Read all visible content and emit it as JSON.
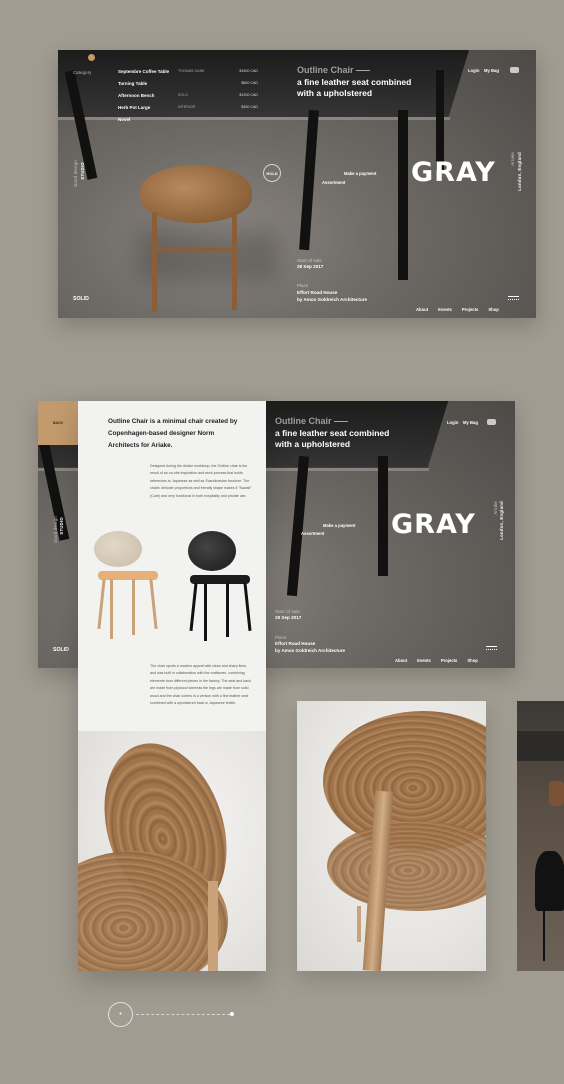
{
  "hero_top": {
    "brand": "SOLID",
    "menu_label": "Category",
    "menu": [
      {
        "name": "Septembre Coffee Table",
        "category": "THOMAS GANE",
        "price": "$1500 CAD"
      },
      {
        "name": "Turning Table",
        "category": "",
        "price": "$800 CAD"
      },
      {
        "name": "Afternoon Bench",
        "category": "SOLD",
        "price": "$1200 CAD"
      },
      {
        "name": "Herb Pot Large",
        "category": "INTERIOR",
        "price": "$300 CAD"
      },
      {
        "name": "Novel",
        "category": "",
        "price": ""
      }
    ],
    "ghost_title": "Outline Chair",
    "lead_line1": "a fine leather seat combined",
    "lead_line2": "with a upholstered",
    "login": "Login",
    "my_bag": "My Bag",
    "hold": "HOLD",
    "make_payment": "Make a payment",
    "assortment": "Assortment",
    "big_word": "GRAY",
    "left_vertical_1": "Good design",
    "left_vertical_2": "STUDIO",
    "right_vertical_1": "Ariake",
    "right_vertical_2": "London, England",
    "date_label": "Start of sale",
    "date": "28 Sep 2017",
    "place_label": "Place",
    "place": "Effort Road House",
    "architect": "by Amos Goldreich Architecture",
    "nav": [
      "About",
      "Events",
      "Projects",
      "Shop"
    ]
  },
  "detail": {
    "back": "BACK",
    "intro": "Outline Chair is a minimal chair created by Copenhagen-based designer Norm Architects for Ariake.",
    "para1": "Designed during the Ariake workshop, the Outline chair is the result of an on-site inspiration and work-process that holds references to Japanese as well as Scandinavian furniture. The chairs' delicate proportions and friendly shape makes it \"Kawaii\" (Cute) and very functional in both hospitality and private use.",
    "para2": "The chair sports a modern appeal with clean and sharp lines, and was built in collaboration with the craftsmen, combining elements from different pieces in the factory. The seat and back are made from plywood whereas the legs are made from solid wood and the chair comes in a version with a fine leather seat combined with a upholstered back in Japanese textile."
  },
  "pager": {
    "current": "•"
  }
}
